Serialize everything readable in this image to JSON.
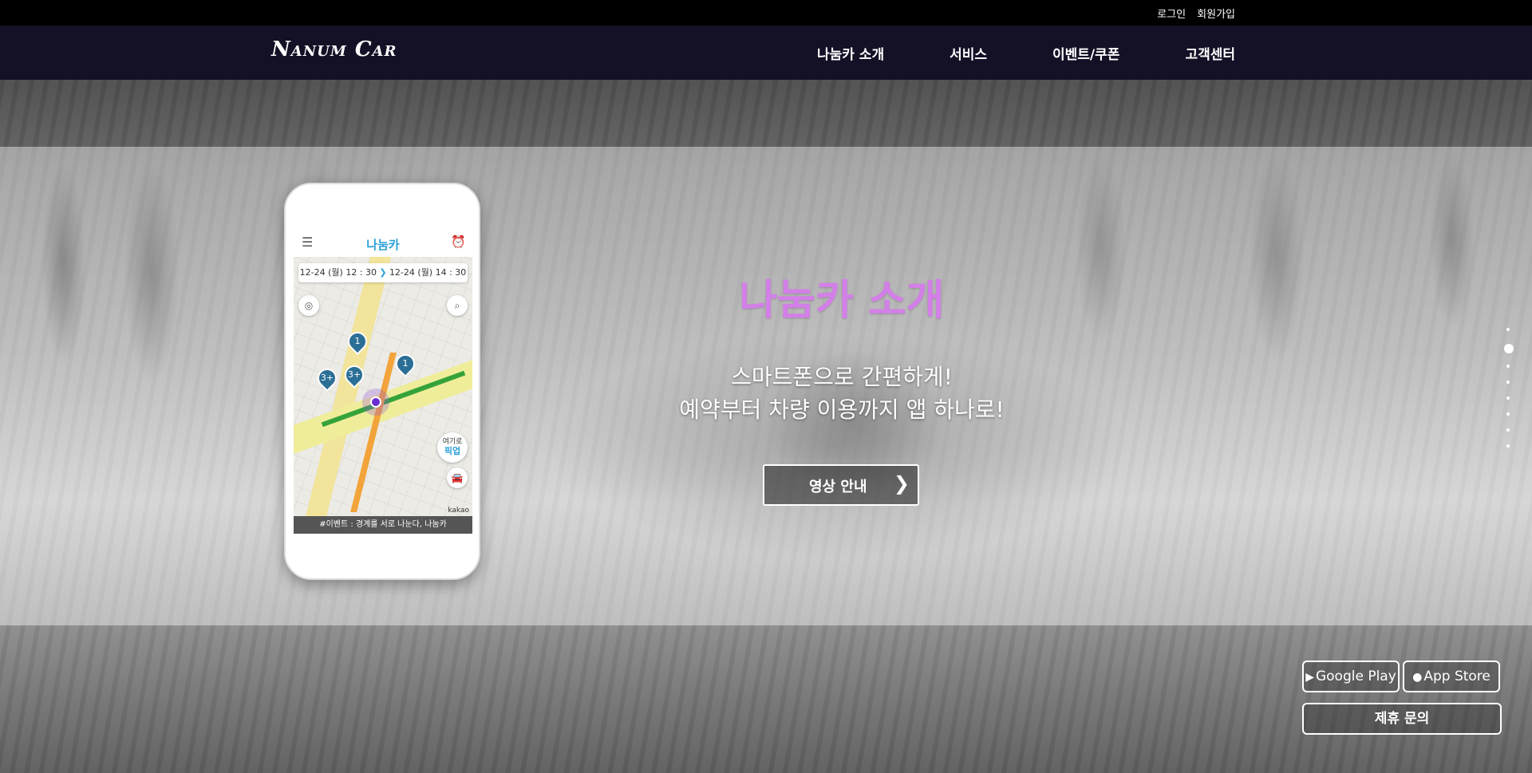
{
  "util": {
    "login": "로그인",
    "signup": "회원가입"
  },
  "brand": {
    "logo": "Nanum Car"
  },
  "nav": {
    "items": [
      "나눔카 소개",
      "서비스",
      "이벤트/쿠폰",
      "고객센터"
    ]
  },
  "hero": {
    "title": "나눔카 소개",
    "line1": "스마트폰으로 간편하게!",
    "line2": "예약부터 차량 이용까지 앱 하나로!",
    "button": "영상 안내"
  },
  "phone": {
    "app_name": "나눔카",
    "from_time": "12-24 (월) 12 : 30",
    "to_time": "12-24 (월) 14 : 30",
    "pins": [
      "1",
      "1",
      "3+",
      "3+"
    ],
    "pickup_top": "여기로",
    "pickup_label": "픽업",
    "map_brand": "kakao",
    "event_text": "#이벤트 : 경계를 서로 나눈다, 나눔카"
  },
  "pagination": {
    "count": 8,
    "active_index": 1
  },
  "stores": {
    "google": "Google Play",
    "apple": "App Store",
    "partner": "제휴 문의"
  },
  "icons": {
    "menu": "hamburger-icon",
    "settings": "bell-icon",
    "chevron": "chevron-right-icon",
    "play": "play-triangle-icon",
    "apple": "apple-icon"
  },
  "colors": {
    "title": "#d47fe9",
    "navbar": "#141026",
    "utilbar": "#000000",
    "app_accent": "#29a0d8"
  }
}
